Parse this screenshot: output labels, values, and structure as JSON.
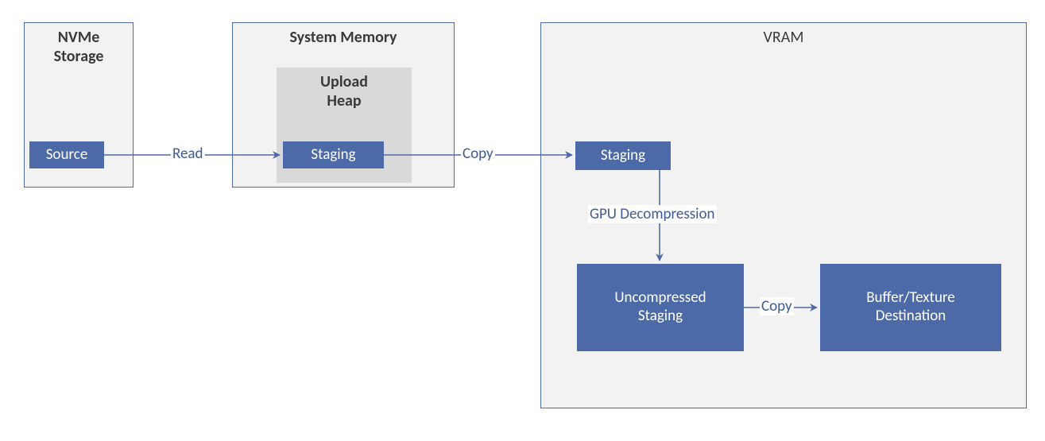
{
  "containers": {
    "nvme": {
      "title": "NVMe\nStorage"
    },
    "sysmem": {
      "title": "System Memory"
    },
    "upload_heap": {
      "title": "Upload\nHeap"
    },
    "vram": {
      "title": "VRAM"
    }
  },
  "nodes": {
    "source": "Source",
    "staging1": "Staging",
    "staging2": "Staging",
    "uncompressed": "Uncompressed\nStaging",
    "destination": "Buffer/Texture\nDestination"
  },
  "edges": {
    "read": "Read",
    "copy1": "Copy",
    "gpu_decompression": "GPU Decompression",
    "copy2": "Copy"
  }
}
